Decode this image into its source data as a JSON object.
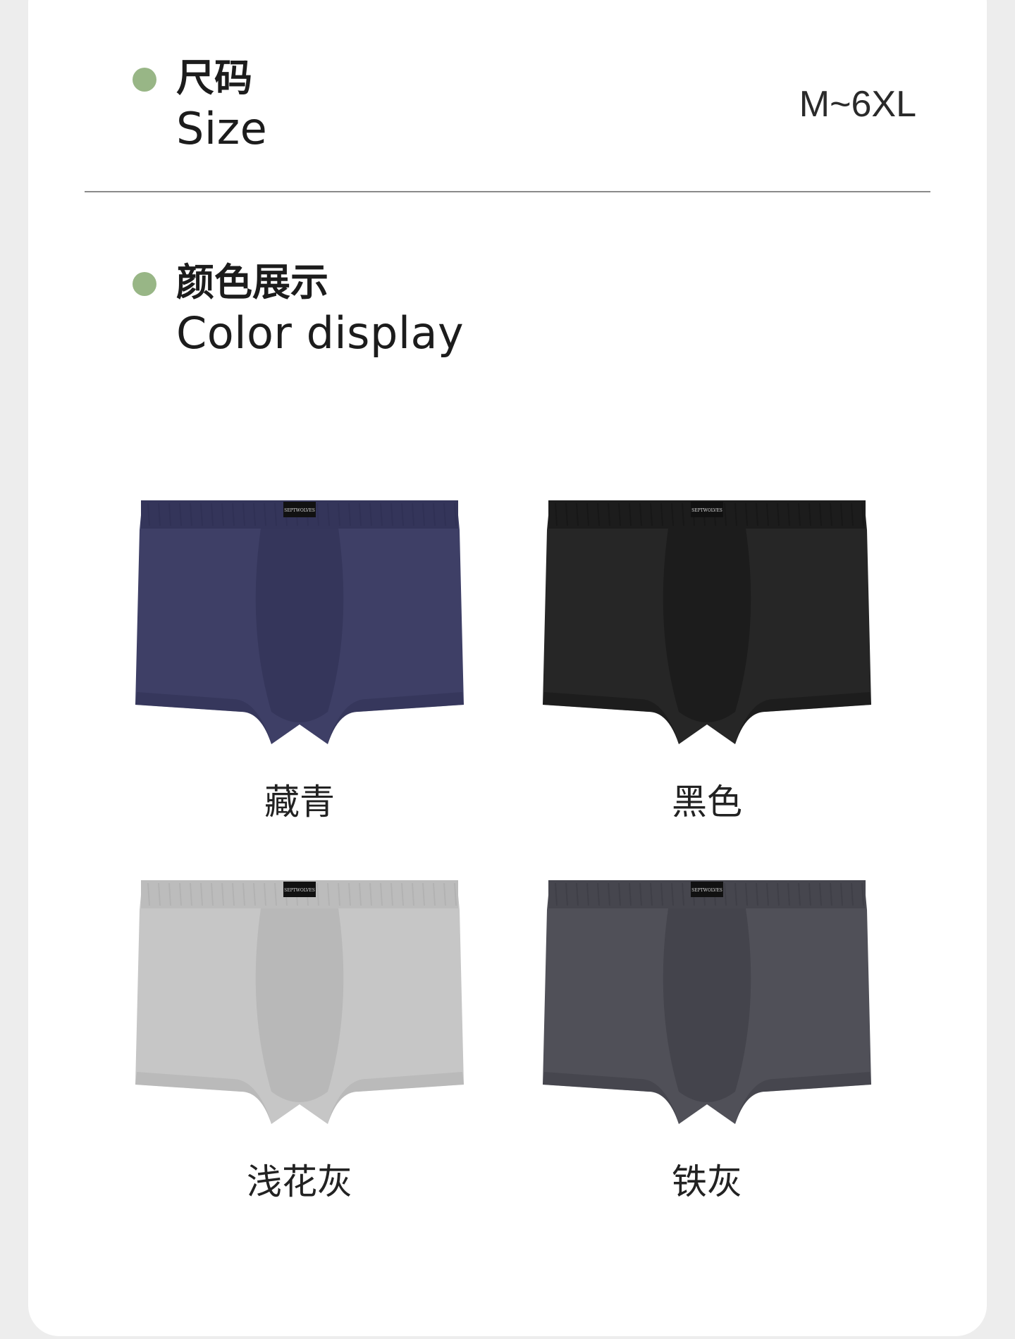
{
  "size": {
    "title_cn": "尺码",
    "title_en": "Size",
    "value": "M~6XL"
  },
  "color_display": {
    "title_cn": "颜色展示",
    "title_en": "Color display"
  },
  "colors": [
    {
      "label": "藏青",
      "fill": "#3e3f66",
      "shade": "#2e2f52",
      "band": "#34355a"
    },
    {
      "label": "黑色",
      "fill": "#262626",
      "shade": "#141414",
      "band": "#1c1c1c"
    },
    {
      "label": "浅花灰",
      "fill": "#c6c6c6",
      "shade": "#adadad",
      "band": "#bcbcbc"
    },
    {
      "label": "铁灰",
      "fill": "#505058",
      "shade": "#3b3b43",
      "band": "#46464e"
    }
  ],
  "brand_tag": "SEPTWOLVES",
  "accent_color": "#98b686"
}
